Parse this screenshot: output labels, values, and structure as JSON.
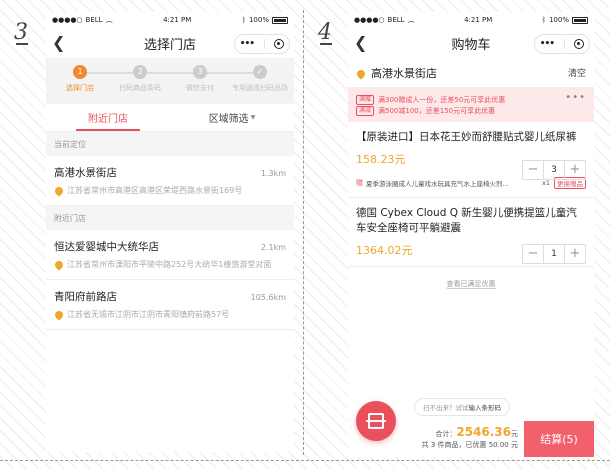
{
  "steps_label": {
    "left": "3",
    "right": "4"
  },
  "left": {
    "status": {
      "carrier": "BELL",
      "time": "4:21 PM",
      "battery": "100%"
    },
    "nav_title": "选择门店",
    "progress": [
      {
        "num": "1",
        "label": "选择门店"
      },
      {
        "num": "2",
        "label": "扫码商品条码"
      },
      {
        "num": "3",
        "label": "微信支付"
      },
      {
        "num": "✓",
        "label": "专用通道扫码出场"
      }
    ],
    "tabs": {
      "nearby": "附近门店",
      "region": "区域筛选"
    },
    "current_label": "当前定位",
    "current_store": {
      "name": "高港水景街店",
      "dist": "1.3km",
      "addr": "江苏省常州市高港区高港区荣堤西路水景街169号"
    },
    "nearby_label": "附近门店",
    "stores": [
      {
        "name": "恒达爱婴城中大统华店",
        "dist": "2.1km",
        "addr": "江苏省常州市溧阳市平陵中路252号大统华1楼悠游堂对面"
      },
      {
        "name": "青阳府前路店",
        "dist": "105.6km",
        "addr": "江苏省无锡市江阴市江阴市青阳镇府前路57号"
      }
    ]
  },
  "right": {
    "status": {
      "carrier": "BELL",
      "time": "4:21 PM",
      "battery": "100%"
    },
    "nav_title": "购物车",
    "store_name": "高港水景街店",
    "clear": "清空",
    "promos": [
      {
        "tag": "满赠",
        "text": "满300赠成人一份，还差50元可享此优惠"
      },
      {
        "tag": "满减",
        "text": "满500减100，还差150元可享此优惠"
      }
    ],
    "items": [
      {
        "title": "【原装进口】日本花王妙而舒腰贴式婴儿纸尿裤",
        "price": "158.23元",
        "qty": "3",
        "gift": {
          "tag": "赠",
          "text": "夏季游泳圈成人儿童戏水玩具充气水上座椅火烈...",
          "count": "x1",
          "btn": "更换赠品"
        }
      },
      {
        "title": "德国 Cybex Cloud Q 新生婴儿便携提篮儿童汽车安全座椅可平躺避震",
        "price": "1364.02元",
        "qty": "1"
      }
    ],
    "see_fulfilled": "查看已满足优惠",
    "scan_hint": {
      "prefix": "扫不出来？试试",
      "link": "输入条形码"
    },
    "total_label": "合计：",
    "total_amount": "2546.36",
    "total_unit": "元",
    "summary": "共 3 件商品，已优惠 50.00 元",
    "checkout": "结算(5)"
  }
}
